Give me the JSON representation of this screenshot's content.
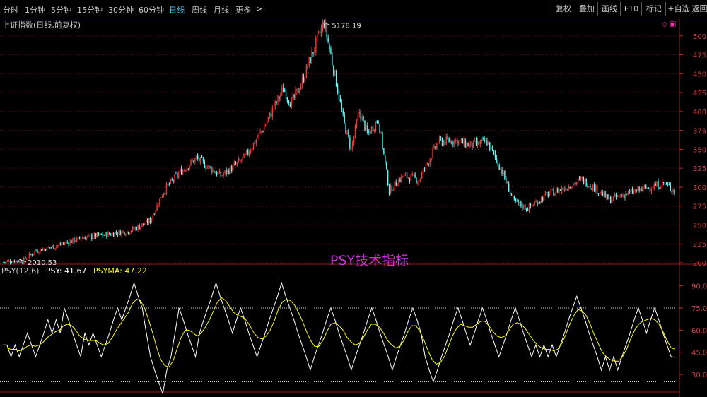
{
  "toolbar": {
    "periods": [
      {
        "label": "分时",
        "active": false
      },
      {
        "label": "1分钟",
        "active": false
      },
      {
        "label": "5分钟",
        "active": false
      },
      {
        "label": "15分钟",
        "active": false
      },
      {
        "label": "30分钟",
        "active": false
      },
      {
        "label": "60分钟",
        "active": false
      },
      {
        "label": "日线",
        "active": true
      },
      {
        "label": "周线",
        "active": false
      },
      {
        "label": "月线",
        "active": false
      },
      {
        "label": "更多",
        "active": false
      }
    ],
    "more_arrow": ">",
    "buttons": [
      "复权",
      "叠加",
      "画线",
      "F10",
      "标记",
      "+自选",
      "返回"
    ]
  },
  "main_chart": {
    "title": "上证指数(日线,前复权)",
    "high_label": "5178.19",
    "low_label": "2010.53",
    "corner_icons": "◇ ▣",
    "y_ticks": [
      "500",
      "475",
      "450",
      "425",
      "400",
      "375",
      "350",
      "325",
      "300",
      "275",
      "250",
      "225",
      "200"
    ]
  },
  "watermark": "PSY技术指标",
  "indicator": {
    "name": "PSY(12,6)",
    "psy_label": "PSY: 41.67",
    "psyma_label": "PSYMA: 47.22",
    "y_ticks": [
      "90.0",
      "75.0",
      "60.0",
      "45.0",
      "30.0"
    ]
  },
  "chart_data": [
    {
      "type": "candlestick",
      "title": "上证指数(日线,前复权)",
      "ylim": [
        2000,
        5250
      ],
      "annotations": [
        {
          "text": "5178.19",
          "value": 5178.19
        },
        {
          "text": "2010.53",
          "value": 2010.53
        }
      ],
      "close_path": [
        {
          "i": 0,
          "v": 2010
        },
        {
          "i": 8,
          "v": 2030
        },
        {
          "i": 14,
          "v": 2025
        },
        {
          "i": 24,
          "v": 2160
        },
        {
          "i": 40,
          "v": 2230
        },
        {
          "i": 58,
          "v": 2330
        },
        {
          "i": 78,
          "v": 2380
        },
        {
          "i": 92,
          "v": 2420
        },
        {
          "i": 100,
          "v": 2480
        },
        {
          "i": 108,
          "v": 2560
        },
        {
          "i": 118,
          "v": 2950
        },
        {
          "i": 130,
          "v": 3200
        },
        {
          "i": 142,
          "v": 3380
        },
        {
          "i": 152,
          "v": 3250
        },
        {
          "i": 160,
          "v": 3150
        },
        {
          "i": 170,
          "v": 3280
        },
        {
          "i": 178,
          "v": 3400
        },
        {
          "i": 192,
          "v": 3800
        },
        {
          "i": 206,
          "v": 4300
        },
        {
          "i": 212,
          "v": 4100
        },
        {
          "i": 220,
          "v": 4400
        },
        {
          "i": 228,
          "v": 4800
        },
        {
          "i": 236,
          "v": 5178
        },
        {
          "i": 246,
          "v": 4300
        },
        {
          "i": 250,
          "v": 3900
        },
        {
          "i": 256,
          "v": 3500
        },
        {
          "i": 262,
          "v": 4000
        },
        {
          "i": 268,
          "v": 3700
        },
        {
          "i": 276,
          "v": 3900
        },
        {
          "i": 284,
          "v": 2950
        },
        {
          "i": 294,
          "v": 3150
        },
        {
          "i": 306,
          "v": 3100
        },
        {
          "i": 320,
          "v": 3600
        },
        {
          "i": 332,
          "v": 3620
        },
        {
          "i": 344,
          "v": 3550
        },
        {
          "i": 356,
          "v": 3600
        },
        {
          "i": 366,
          "v": 3250
        },
        {
          "i": 376,
          "v": 2800
        },
        {
          "i": 386,
          "v": 2720
        },
        {
          "i": 400,
          "v": 2900
        },
        {
          "i": 414,
          "v": 3000
        },
        {
          "i": 426,
          "v": 3100
        },
        {
          "i": 436,
          "v": 2980
        },
        {
          "i": 446,
          "v": 2830
        },
        {
          "i": 460,
          "v": 2920
        },
        {
          "i": 476,
          "v": 3000
        },
        {
          "i": 486,
          "v": 3050
        },
        {
          "i": 494,
          "v": 2950
        }
      ]
    },
    {
      "type": "line",
      "title": "PSY(12,6)",
      "ylim": [
        20,
        97
      ],
      "series": [
        {
          "name": "PSY",
          "color": "#ffffff",
          "last": 41.67,
          "values": [
            50,
            50,
            42,
            50,
            42,
            50,
            58,
            50,
            42,
            50,
            58,
            67,
            58,
            67,
            58,
            75,
            67,
            58,
            50,
            42,
            58,
            50,
            58,
            50,
            42,
            50,
            58,
            67,
            75,
            67,
            75,
            83,
            92,
            83,
            75,
            58,
            42,
            33,
            25,
            17,
            33,
            42,
            58,
            75,
            67,
            58,
            50,
            42,
            58,
            67,
            75,
            83,
            92,
            83,
            75,
            67,
            58,
            67,
            75,
            67,
            58,
            50,
            42,
            50,
            58,
            67,
            75,
            83,
            92,
            83,
            75,
            67,
            58,
            50,
            42,
            33,
            42,
            50,
            58,
            67,
            75,
            67,
            58,
            50,
            42,
            33,
            42,
            50,
            58,
            67,
            75,
            67,
            58,
            50,
            42,
            33,
            42,
            50,
            58,
            67,
            75,
            67,
            58,
            42,
            33,
            25,
            33,
            42,
            50,
            58,
            67,
            75,
            67,
            58,
            50,
            58,
            67,
            75,
            67,
            58,
            50,
            42,
            50,
            58,
            67,
            75,
            67,
            58,
            50,
            42,
            50,
            42,
            50,
            42,
            50,
            42,
            50,
            58,
            67,
            75,
            83,
            75,
            67,
            58,
            50,
            42,
            33,
            42,
            33,
            42,
            33,
            42,
            50,
            58,
            67,
            75,
            67,
            58,
            67,
            75,
            67,
            58,
            50,
            42,
            41.67
          ]
        },
        {
          "name": "PSYMA",
          "color": "#ffff00",
          "last": 47.22,
          "values": [
            48,
            48,
            47,
            47,
            46,
            47,
            49,
            50,
            49,
            50,
            52,
            55,
            57,
            59,
            60,
            63,
            64,
            63,
            60,
            56,
            54,
            53,
            53,
            53,
            51,
            50,
            51,
            55,
            60,
            64,
            68,
            72,
            78,
            81,
            80,
            75,
            67,
            58,
            48,
            40,
            36,
            35,
            39,
            47,
            55,
            60,
            60,
            58,
            56,
            58,
            62,
            67,
            73,
            79,
            82,
            80,
            76,
            72,
            70,
            69,
            67,
            63,
            58,
            55,
            54,
            56,
            60,
            66,
            74,
            79,
            81,
            80,
            77,
            72,
            66,
            59,
            53,
            49,
            49,
            53,
            59,
            64,
            65,
            63,
            60,
            55,
            52,
            50,
            51,
            55,
            60,
            64,
            64,
            62,
            58,
            53,
            50,
            48,
            49,
            53,
            59,
            63,
            63,
            59,
            53,
            46,
            40,
            37,
            38,
            42,
            49,
            56,
            61,
            64,
            63,
            62,
            62,
            64,
            66,
            66,
            63,
            59,
            56,
            55,
            56,
            60,
            64,
            65,
            64,
            61,
            57,
            53,
            50,
            48,
            47,
            47,
            46,
            47,
            51,
            57,
            64,
            70,
            74,
            73,
            70,
            64,
            57,
            51,
            45,
            42,
            40,
            39,
            39,
            42,
            47,
            54,
            60,
            64,
            66,
            67,
            68,
            67,
            64,
            59,
            53,
            48,
            47.22
          ]
        }
      ],
      "reference_lines": [
        75,
        25
      ]
    }
  ]
}
